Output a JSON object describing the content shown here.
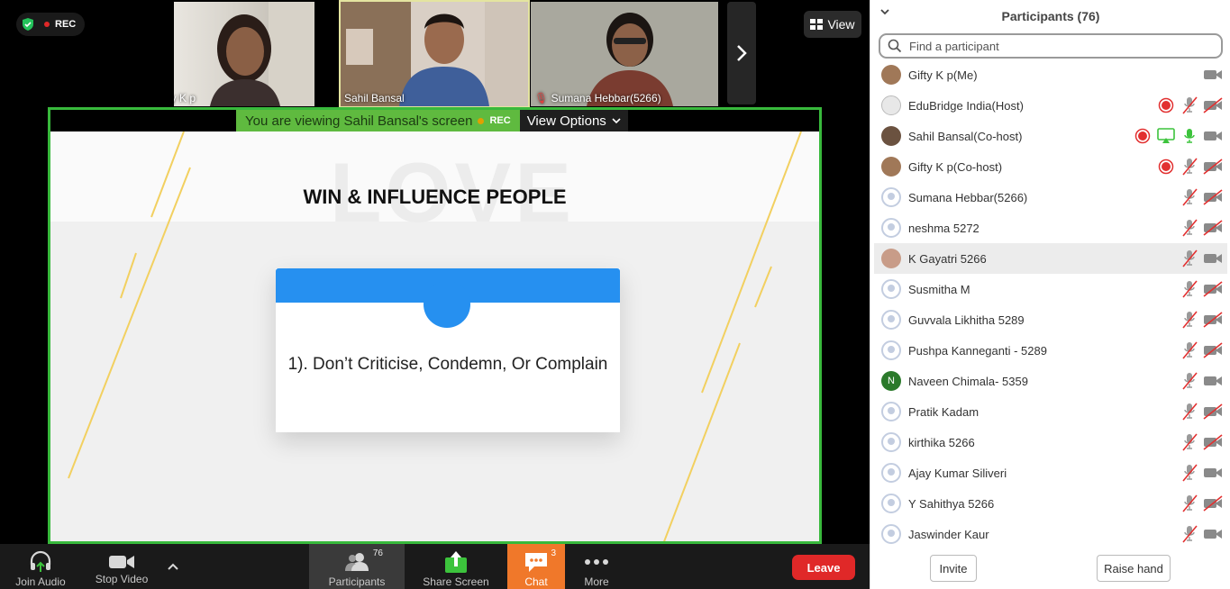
{
  "meeting": {
    "rec_label": "REC",
    "view_label": "View",
    "tiles": [
      {
        "name": "Gifty K p"
      },
      {
        "name": "Sahil Bansal"
      },
      {
        "name": "Sumana Hebbar(5266)"
      }
    ]
  },
  "share": {
    "banner_text": "You are viewing Sahil Bansal's screen",
    "banner_rec": "REC",
    "view_options_label": "View Options",
    "slide_watermark": "LOVE",
    "slide_title": "WIN & INFLUENCE PEOPLE",
    "slide_point": "1). Don’t Criticise, Condemn, Or Complain"
  },
  "toolbar": {
    "join_audio": "Join Audio",
    "stop_video": "Stop Video",
    "participants": "Participants",
    "participants_count": "76",
    "share_screen": "Share Screen",
    "chat": "Chat",
    "chat_count": "3",
    "more": "More",
    "leave": "Leave"
  },
  "panel": {
    "title": "Participants (76)",
    "search_placeholder": "Find a participant",
    "invite_label": "Invite",
    "raise_hand_label": "Raise hand",
    "participants": [
      {
        "name": "Gifty K p(Me)",
        "avatar": "photo1",
        "rec": false,
        "share": false,
        "mic": "none",
        "video": "on"
      },
      {
        "name": "EduBridge India(Host)",
        "avatar": "photo2",
        "rec": true,
        "share": false,
        "mic": "muted",
        "video": "off"
      },
      {
        "name": "Sahil Bansal(Co-host)",
        "avatar": "photo3",
        "rec": true,
        "share": true,
        "mic": "on",
        "video": "on"
      },
      {
        "name": "Gifty K p(Co-host)",
        "avatar": "photo1",
        "rec": true,
        "share": false,
        "mic": "muted",
        "video": "off"
      },
      {
        "name": "Sumana Hebbar(5266)",
        "avatar": "default",
        "rec": false,
        "share": false,
        "mic": "muted",
        "video": "off"
      },
      {
        "name": "neshma 5272",
        "avatar": "default",
        "rec": false,
        "share": false,
        "mic": "muted",
        "video": "off"
      },
      {
        "name": "K Gayatri 5266",
        "avatar": "photo4",
        "rec": false,
        "share": false,
        "mic": "muted",
        "video": "on"
      },
      {
        "name": "Susmitha M",
        "avatar": "default",
        "rec": false,
        "share": false,
        "mic": "muted",
        "video": "off"
      },
      {
        "name": "Guvvala Likhitha 5289",
        "avatar": "default",
        "rec": false,
        "share": false,
        "mic": "muted",
        "video": "off"
      },
      {
        "name": "Pushpa Kanneganti - 5289",
        "avatar": "default",
        "rec": false,
        "share": false,
        "mic": "muted",
        "video": "off"
      },
      {
        "name": "Naveen Chimala- 5359",
        "avatar": "letter",
        "letter": "N",
        "rec": false,
        "share": false,
        "mic": "muted",
        "video": "on"
      },
      {
        "name": "Pratik Kadam",
        "avatar": "default",
        "rec": false,
        "share": false,
        "mic": "muted",
        "video": "off"
      },
      {
        "name": "kirthika 5266",
        "avatar": "default",
        "rec": false,
        "share": false,
        "mic": "muted",
        "video": "off"
      },
      {
        "name": "Ajay Kumar Siliveri",
        "avatar": "default",
        "rec": false,
        "share": false,
        "mic": "muted",
        "video": "on"
      },
      {
        "name": "Y Sahithya 5266",
        "avatar": "default",
        "rec": false,
        "share": false,
        "mic": "muted",
        "video": "off"
      },
      {
        "name": "Jaswinder Kaur",
        "avatar": "default",
        "rec": false,
        "share": false,
        "mic": "muted",
        "video": "on"
      }
    ]
  },
  "colors": {
    "share_border": "#38b93c",
    "leave": "#e02828",
    "chat_active": "#f0782a",
    "slide_accent": "#2690f0",
    "rec_red": "#e02828"
  }
}
